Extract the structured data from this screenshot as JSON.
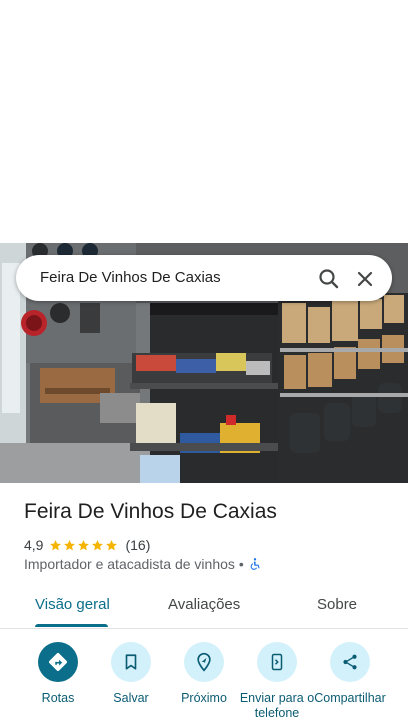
{
  "search": {
    "query": "Feira De Vinhos De Caxias"
  },
  "place": {
    "title": "Feira De Vinhos De Caxias",
    "rating": "4,9",
    "stars": 5,
    "review_count": "(16)",
    "category": "Importador e atacadista de vinhos",
    "separator": "•"
  },
  "tabs": [
    {
      "label": "Visão geral",
      "active": true
    },
    {
      "label": "Avaliações",
      "active": false
    },
    {
      "label": "Sobre",
      "active": false
    }
  ],
  "actions": [
    {
      "label": "Rotas",
      "icon": "directions-icon"
    },
    {
      "label": "Salvar",
      "icon": "bookmark-icon"
    },
    {
      "label": "Próximo",
      "icon": "nearby-icon"
    },
    {
      "label": "Enviar para o telefone",
      "icon": "send-to-phone-icon"
    },
    {
      "label": "Compartilhar",
      "icon": "share-icon"
    }
  ],
  "colors": {
    "accent": "#0b6e8a",
    "action_bg": "#d3f1fb",
    "star": "#f4b400"
  }
}
